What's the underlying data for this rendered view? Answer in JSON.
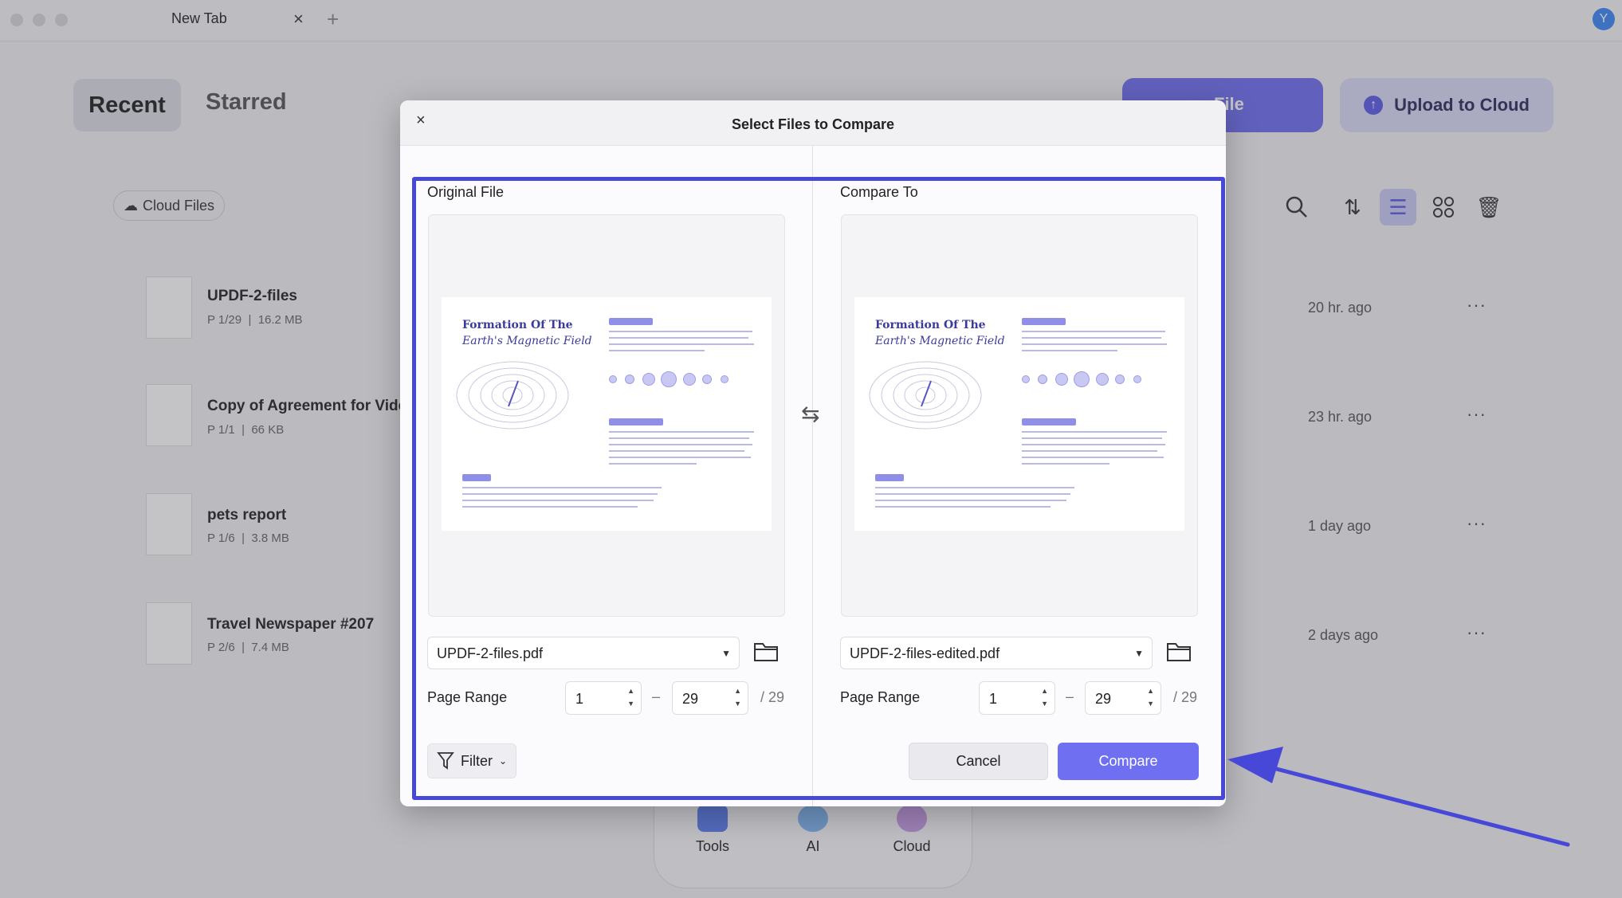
{
  "browser": {
    "tab_title": "New Tab",
    "avatar_letter": "Y"
  },
  "home": {
    "tabs": [
      "Recent",
      "Starred"
    ],
    "open_file_label": "File",
    "upload_label": "Upload to Cloud",
    "cloud_files_label": "Cloud Files",
    "files": [
      {
        "name": "UPDF-2-files",
        "pages": "P 1/29",
        "size": "16.2 MB",
        "time": "20 hr. ago"
      },
      {
        "name": "Copy of Agreement for Video",
        "pages": "P 1/1",
        "size": "66 KB",
        "time": "23 hr. ago"
      },
      {
        "name": "pets report",
        "pages": "P 1/6",
        "size": "3.8 MB",
        "time": "1 day ago"
      },
      {
        "name": "Travel Newspaper #207",
        "pages": "P 2/6",
        "size": "7.4 MB",
        "time": "2 days ago"
      }
    ],
    "dock": [
      "Tools",
      "AI",
      "Cloud"
    ]
  },
  "dialog": {
    "title": "Select Files to Compare",
    "close": "×",
    "original": {
      "label": "Original File",
      "file": "UPDF-2-files.pdf",
      "page_range_label": "Page Range",
      "from": "1",
      "to": "29",
      "total": "/ 29"
    },
    "compare": {
      "label": "Compare To",
      "file": "UPDF-2-files-edited.pdf",
      "page_range_label": "Page Range",
      "from": "1",
      "to": "29",
      "total": "/ 29"
    },
    "preview": {
      "title_line1": "Formation Of The",
      "title_line2": "Earth's Magnetic Field"
    },
    "dash": "–",
    "filter_label": "Filter",
    "cancel_label": "Cancel",
    "compare_label": "Compare"
  },
  "colors": {
    "accent": "#6f6ff2",
    "highlight": "#4747d8"
  }
}
